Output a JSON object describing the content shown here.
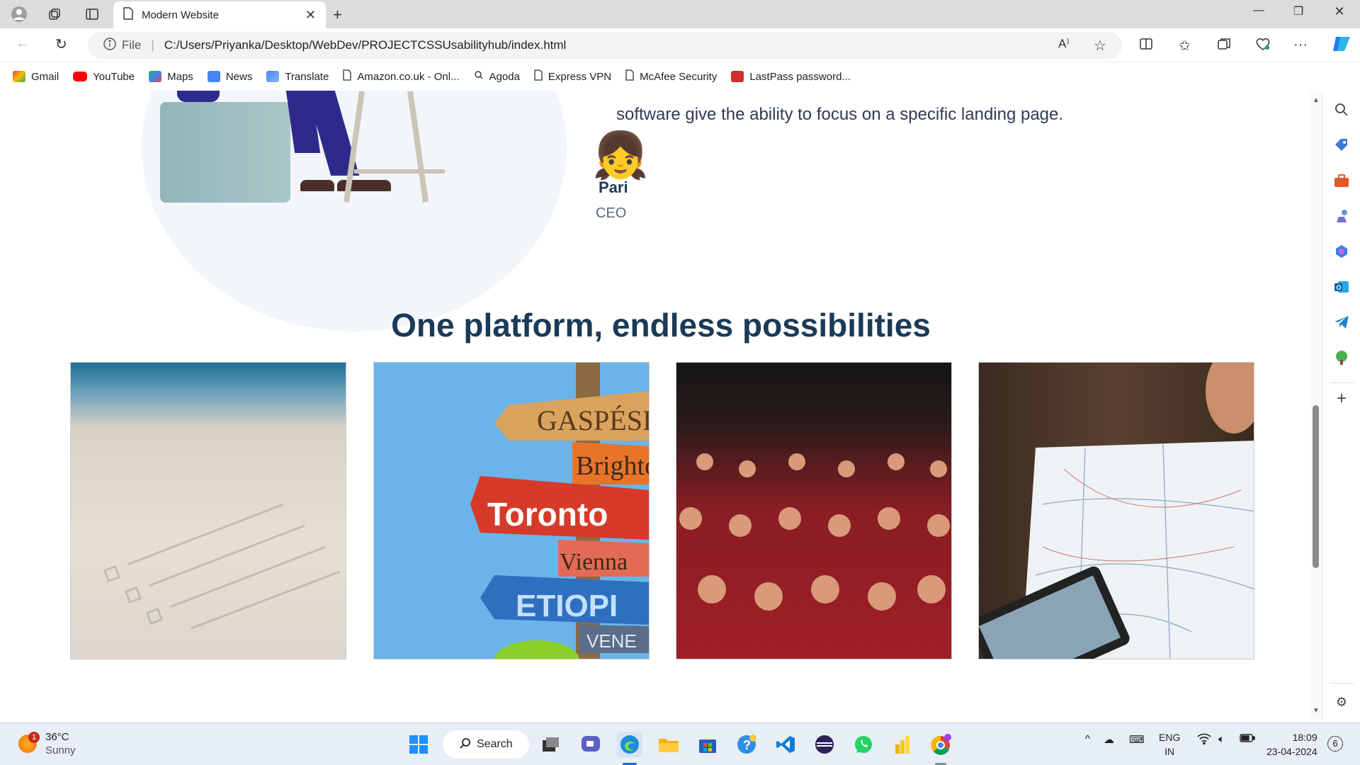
{
  "browser": {
    "tab_title": "Modern Website",
    "url_scheme": "File",
    "url": "C:/Users/Priyanka/Desktop/WebDev/PROJECTCSSUsabilityhub/index.html"
  },
  "bookmarks": [
    {
      "label": "Gmail",
      "color": "#ea4335"
    },
    {
      "label": "YouTube",
      "color": "#ff0000"
    },
    {
      "label": "Maps",
      "color": "#34a853"
    },
    {
      "label": "News",
      "color": "#4285f4"
    },
    {
      "label": "Translate",
      "color": "#4285f4"
    },
    {
      "label": "Amazon.co.uk - Onl...",
      "color": "#666666"
    },
    {
      "label": "Agoda",
      "color": "#666666"
    },
    {
      "label": "Express VPN",
      "color": "#666666"
    },
    {
      "label": "McAfee Security",
      "color": "#666666"
    },
    {
      "label": "LastPass password...",
      "color": "#d32d27"
    }
  ],
  "testimonial": {
    "text": "software give the ability to focus on a specific landing page.",
    "name": "Pari",
    "role": "CEO",
    "avatar": "👧"
  },
  "section": {
    "heading": "One platform, endless possibilities"
  },
  "gallery": [
    {
      "name": "checklist-image"
    },
    {
      "name": "signpost-image",
      "signs": [
        "GASPÉSI",
        "Brighto",
        "Toronto",
        "Vienna",
        "ETIOPI",
        "VENE"
      ]
    },
    {
      "name": "audience-image"
    },
    {
      "name": "map-image"
    }
  ],
  "taskbar": {
    "weather_temp": "36°C",
    "weather_desc": "Sunny",
    "weather_badge": "1",
    "search_label": "Search",
    "lang_top": "ENG",
    "lang_bottom": "IN",
    "time": "18:09",
    "date": "23-04-2024",
    "notif_count": "6"
  }
}
